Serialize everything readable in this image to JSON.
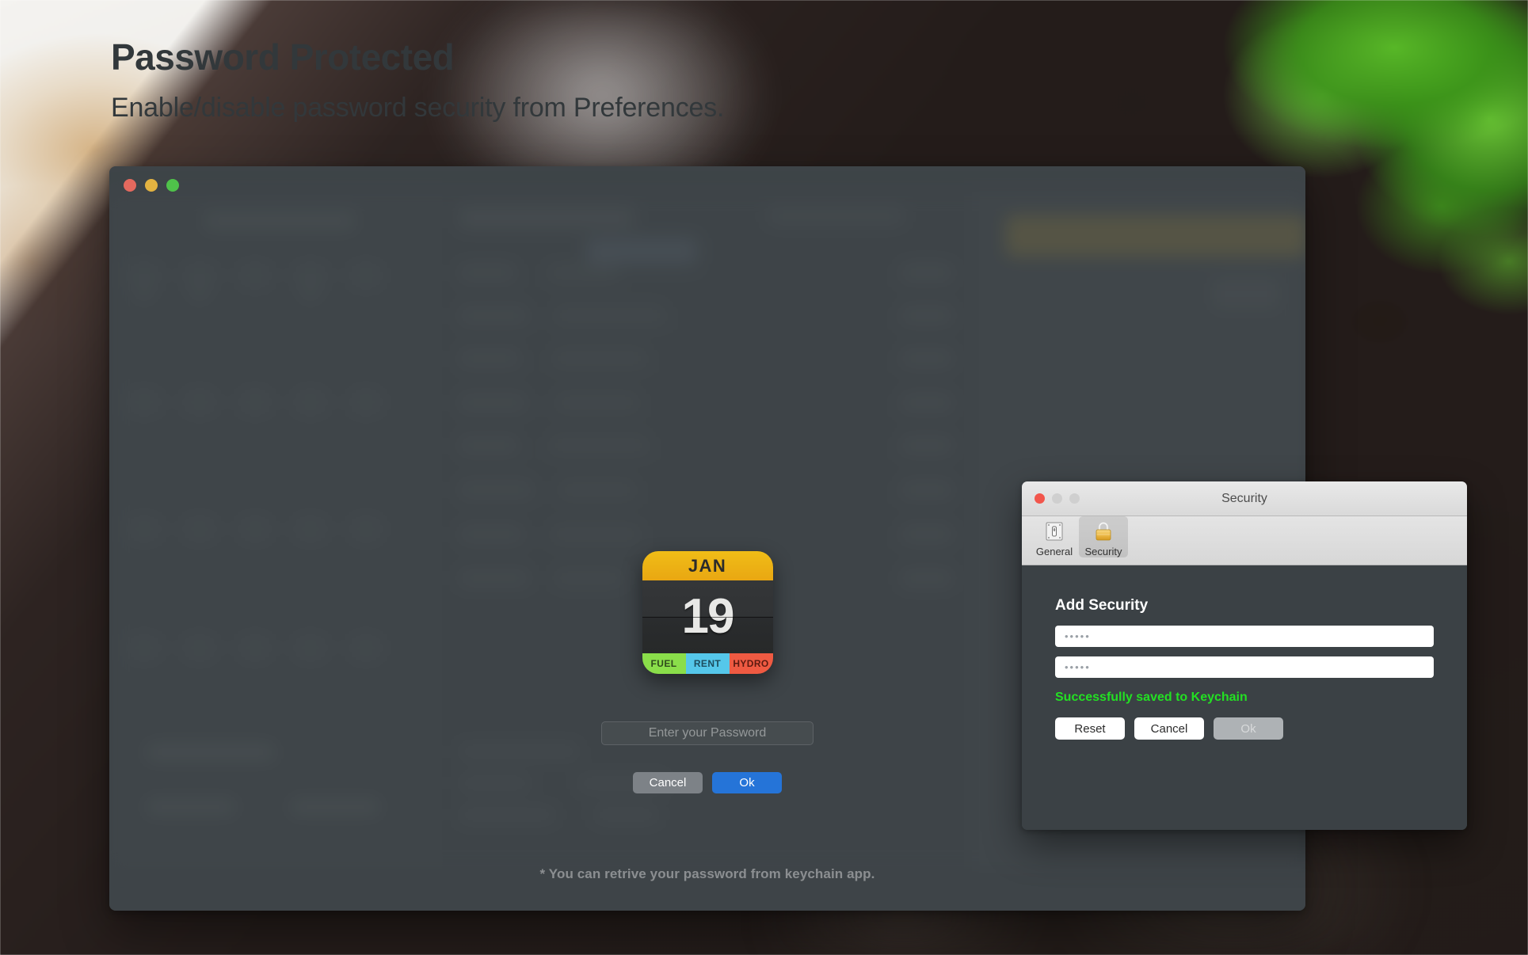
{
  "headings": {
    "title": "Password Protected",
    "subtitle": "Enable/disable password security from Preferences."
  },
  "app_window": {
    "traffic_lights": {
      "close": "close-button",
      "minimize": "minimize-button",
      "maximize": "maximize-button"
    },
    "footer_note": "* You can retrive your password from keychain app."
  },
  "password_modal": {
    "calendar_icon": {
      "month": "JAN",
      "day": "19",
      "tabs": [
        "FUEL",
        "RENT",
        "HYDRO"
      ],
      "tab_colors": [
        "#8ade4a",
        "#55c7ea",
        "#ef5a42"
      ],
      "header_color": "#eeb714"
    },
    "password_field": {
      "value": "",
      "placeholder": "Enter your Password"
    },
    "cancel_label": "Cancel",
    "ok_label": "Ok",
    "ok_color": "#2574d8"
  },
  "security_window": {
    "title": "Security",
    "tabs": [
      {
        "label": "General",
        "icon": "switch-plate-icon",
        "active": false
      },
      {
        "label": "Security",
        "icon": "padlock-icon",
        "active": true
      }
    ],
    "heading": "Add Security",
    "fields": [
      {
        "name": "password-field",
        "value": "•••••"
      },
      {
        "name": "confirm-password-field",
        "value": "•••••"
      }
    ],
    "status_message": "Successfully saved to Keychain",
    "status_color": "#23e023",
    "buttons": [
      {
        "label": "Reset",
        "disabled": false
      },
      {
        "label": "Cancel",
        "disabled": false
      },
      {
        "label": "Ok",
        "disabled": true
      }
    ]
  }
}
